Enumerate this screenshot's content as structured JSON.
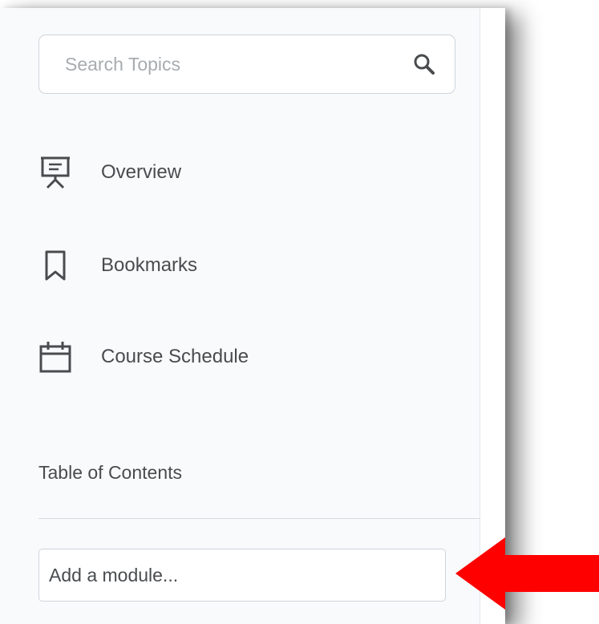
{
  "search": {
    "placeholder": "Search Topics",
    "icon": "search-icon"
  },
  "nav": {
    "items": [
      {
        "label": "Overview",
        "icon": "presentation-icon"
      },
      {
        "label": "Bookmarks",
        "icon": "bookmark-icon"
      },
      {
        "label": "Course Schedule",
        "icon": "calendar-icon"
      }
    ]
  },
  "toc": {
    "heading": "Table of Contents",
    "add_module_placeholder": "Add a module..."
  },
  "annotation": {
    "arrow_color": "#ff0000",
    "icon": "arrow-left-icon"
  },
  "colors": {
    "panel_bg": "#f9fafb",
    "text": "#494c4e",
    "border": "#cdd5dc",
    "placeholder": "#a8acaf"
  }
}
